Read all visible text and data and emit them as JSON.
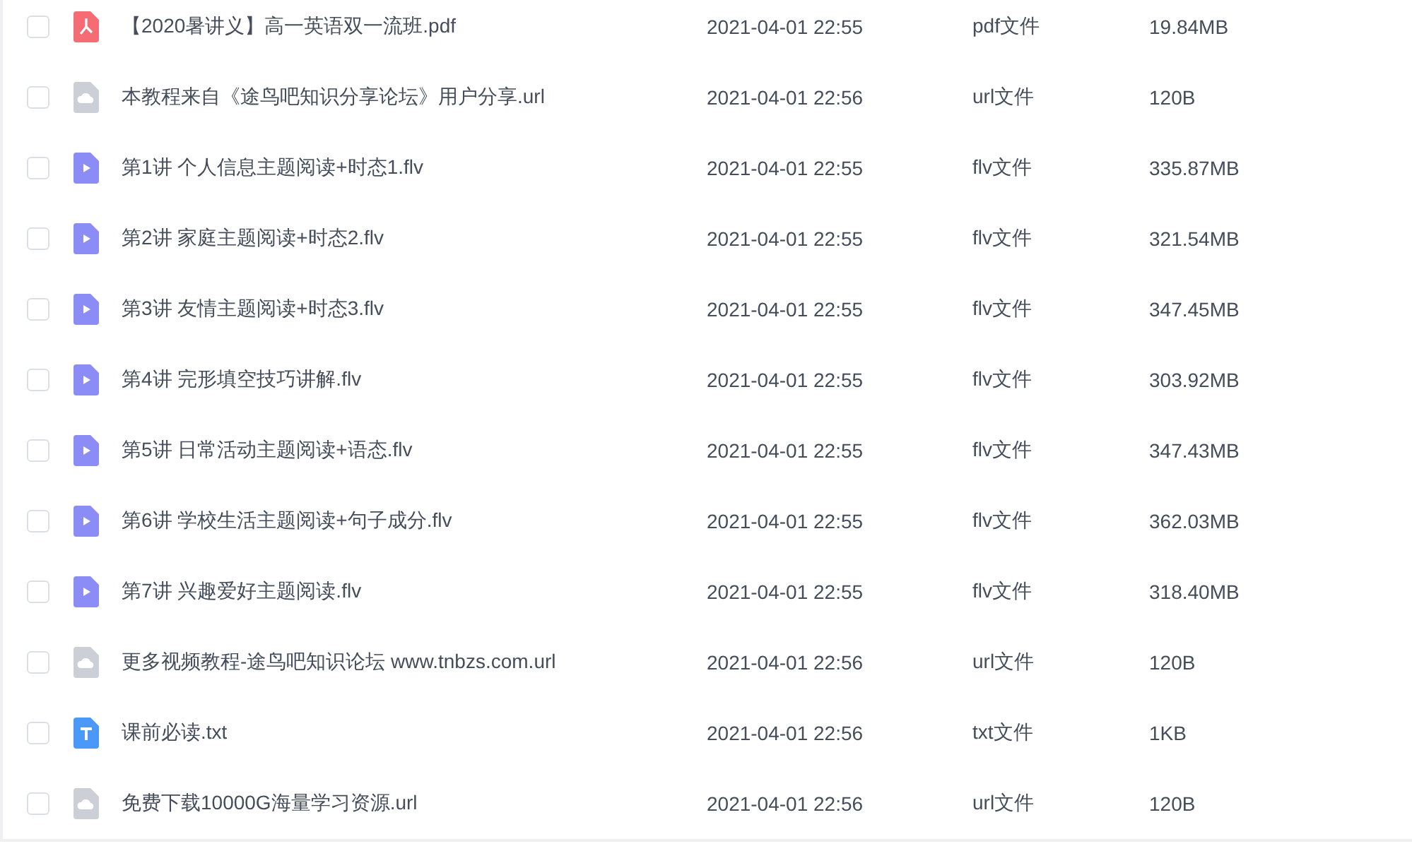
{
  "files": [
    {
      "kind": "pdf",
      "name": "【2020暑讲义】高一英语双一流班.pdf",
      "date": "2021-04-01 22:55",
      "type": "pdf文件",
      "size": "19.84MB",
      "checked": false
    },
    {
      "kind": "url",
      "name": "本教程来自《途鸟吧知识分享论坛》用户分享.url",
      "date": "2021-04-01 22:56",
      "type": "url文件",
      "size": "120B",
      "checked": false
    },
    {
      "kind": "video",
      "name": "第1讲 个人信息主题阅读+时态1.flv",
      "date": "2021-04-01 22:55",
      "type": "flv文件",
      "size": "335.87MB",
      "checked": false
    },
    {
      "kind": "video",
      "name": "第2讲 家庭主题阅读+时态2.flv",
      "date": "2021-04-01 22:55",
      "type": "flv文件",
      "size": "321.54MB",
      "checked": false
    },
    {
      "kind": "video",
      "name": "第3讲 友情主题阅读+时态3.flv",
      "date": "2021-04-01 22:55",
      "type": "flv文件",
      "size": "347.45MB",
      "checked": false
    },
    {
      "kind": "video",
      "name": "第4讲 完形填空技巧讲解.flv",
      "date": "2021-04-01 22:55",
      "type": "flv文件",
      "size": "303.92MB",
      "checked": false
    },
    {
      "kind": "video",
      "name": "第5讲 日常活动主题阅读+语态.flv",
      "date": "2021-04-01 22:55",
      "type": "flv文件",
      "size": "347.43MB",
      "checked": false
    },
    {
      "kind": "video",
      "name": "第6讲 学校生活主题阅读+句子成分.flv",
      "date": "2021-04-01 22:55",
      "type": "flv文件",
      "size": "362.03MB",
      "checked": false
    },
    {
      "kind": "video",
      "name": "第7讲 兴趣爱好主题阅读.flv",
      "date": "2021-04-01 22:55",
      "type": "flv文件",
      "size": "318.40MB",
      "checked": false
    },
    {
      "kind": "url",
      "name": "更多视频教程-途鸟吧知识论坛 www.tnbzs.com.url",
      "date": "2021-04-01 22:56",
      "type": "url文件",
      "size": "120B",
      "checked": false
    },
    {
      "kind": "txt",
      "name": "课前必读.txt",
      "date": "2021-04-01 22:56",
      "type": "txt文件",
      "size": "1KB",
      "checked": false
    },
    {
      "kind": "url",
      "name": "免费下载10000G海量学习资源.url",
      "date": "2021-04-01 22:56",
      "type": "url文件",
      "size": "120B",
      "checked": false
    }
  ]
}
